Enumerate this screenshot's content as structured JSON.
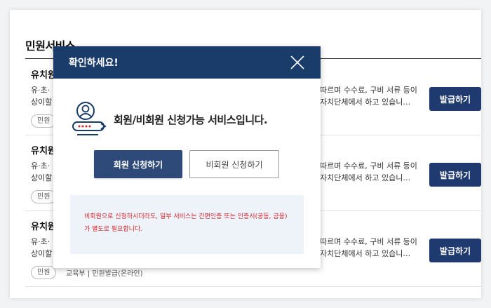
{
  "page": {
    "section_title": "민원서비스",
    "rows": [
      {
        "title": "유치원",
        "desc_left_1": "유·초·",
        "desc_left_2": "상이할",
        "desc_right_1": "따르며 수수료, 구비 서류 등이",
        "desc_right_2": "자치단체에서 하고 있습니…",
        "tag": "민원",
        "meta": "",
        "button": "발급하기"
      },
      {
        "title": "유치원",
        "desc_left_1": "유·초·",
        "desc_left_2": "상이할",
        "desc_right_1": "따르며 수수료, 구비 서류 등이",
        "desc_right_2": "자치단체에서 하고 있습니…",
        "tag": "민원",
        "meta": "",
        "button": "발급하기"
      },
      {
        "title": "유치원",
        "desc_left_1": "유·초·",
        "desc_left_2": "상이할",
        "desc_right_1": "따르며 수수료, 구비 서류 등이",
        "desc_right_2": "자치단체에서 하고 있습니…",
        "tag": "민원",
        "meta": "교육부 | 민원발급(온라인)",
        "button": "발급하기"
      }
    ]
  },
  "modal": {
    "title": "확인하세요!",
    "close_icon": "close-icon",
    "notice_icon": "user-id-card-icon",
    "notice_text": "회원/비회원 신청가능 서비스입니다.",
    "member_button": "회원 신청하기",
    "nonmember_button": "비회원 신청하기",
    "info_text": "비회원으로 신청하시더라도, 일부 서비스는 간편인증 또는 인증서(공동, 금융) 가 별도로 필요합니다."
  },
  "colors": {
    "header": "#1a3c6b",
    "primary_button": "#2e4a78",
    "issue_button": "#1f3a6e",
    "info_background": "#eef3f9",
    "info_text": "#d0262e"
  }
}
